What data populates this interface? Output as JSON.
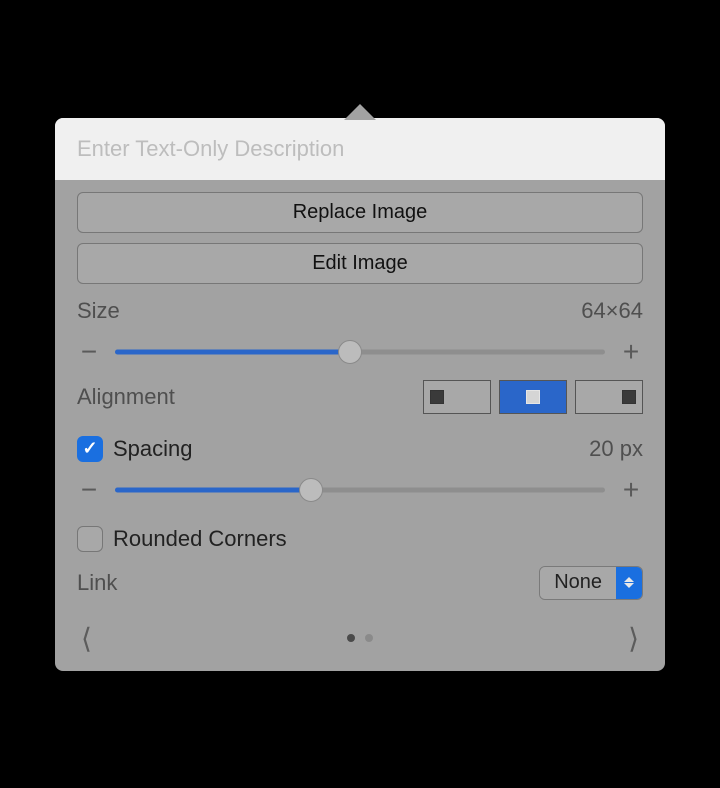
{
  "description": {
    "placeholder": "Enter Text-Only Description",
    "value": ""
  },
  "buttons": {
    "replace": "Replace Image",
    "edit": "Edit Image"
  },
  "size": {
    "label": "Size",
    "value": "64×64",
    "slider_percent": 48
  },
  "alignment": {
    "label": "Alignment",
    "selected": "center"
  },
  "spacing": {
    "label": "Spacing",
    "enabled": true,
    "value": "20 px",
    "slider_percent": 40
  },
  "rounded": {
    "label": "Rounded Corners",
    "enabled": false
  },
  "link": {
    "label": "Link",
    "selected": "None"
  },
  "pager": {
    "current": 1,
    "total": 2
  }
}
